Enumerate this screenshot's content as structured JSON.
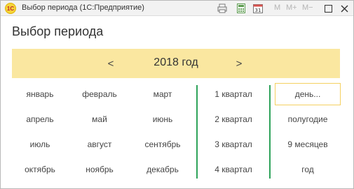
{
  "window": {
    "logo_text": "1С",
    "title": "Выбор периода  (1С:Предприятие)",
    "memory_buttons": [
      "M",
      "M+",
      "M−"
    ],
    "calendar_day": "31"
  },
  "dialog": {
    "heading": "Выбор периода"
  },
  "year_nav": {
    "prev_label": "<",
    "year": "2018 год",
    "next_label": ">"
  },
  "months": [
    [
      "январь",
      "февраль",
      "март"
    ],
    [
      "апрель",
      "май",
      "июнь"
    ],
    [
      "июль",
      "август",
      "сентябрь"
    ],
    [
      "октябрь",
      "ноябрь",
      "декабрь"
    ]
  ],
  "quarters": [
    "1 квартал",
    "2 квартал",
    "3 квартал",
    "4 квартал"
  ],
  "periods": [
    "день...",
    "полугодие",
    "9 месяцев",
    "год"
  ],
  "colors": {
    "year_band": "#fae7a0",
    "divider": "#2ea35a",
    "selected_border": "#f5d060"
  }
}
